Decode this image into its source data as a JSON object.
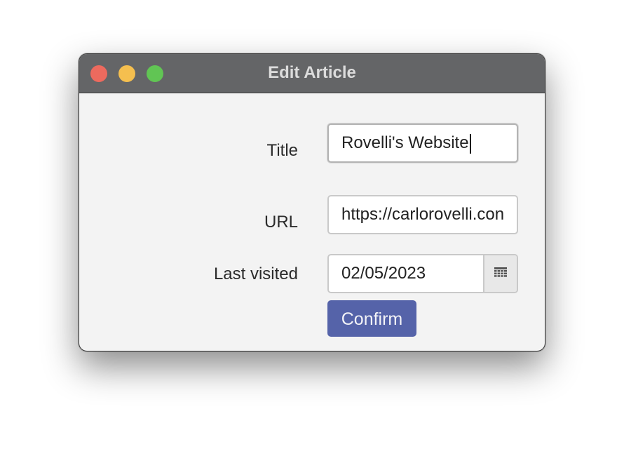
{
  "window": {
    "title": "Edit Article"
  },
  "form": {
    "title_label": "Title",
    "title_value": "Rovelli's Website",
    "url_label": "URL",
    "url_value": "https://carlorovelli.con",
    "last_visited_label": "Last visited",
    "last_visited_value": "02/05/2023",
    "confirm_label": "Confirm"
  },
  "icons": {
    "calendar": "calendar-icon"
  },
  "colors": {
    "titlebar": "#646567",
    "confirm_button": "#5563a9",
    "close": "#ed6a5e",
    "minimize": "#f5bf4f",
    "maximize": "#61c554"
  }
}
